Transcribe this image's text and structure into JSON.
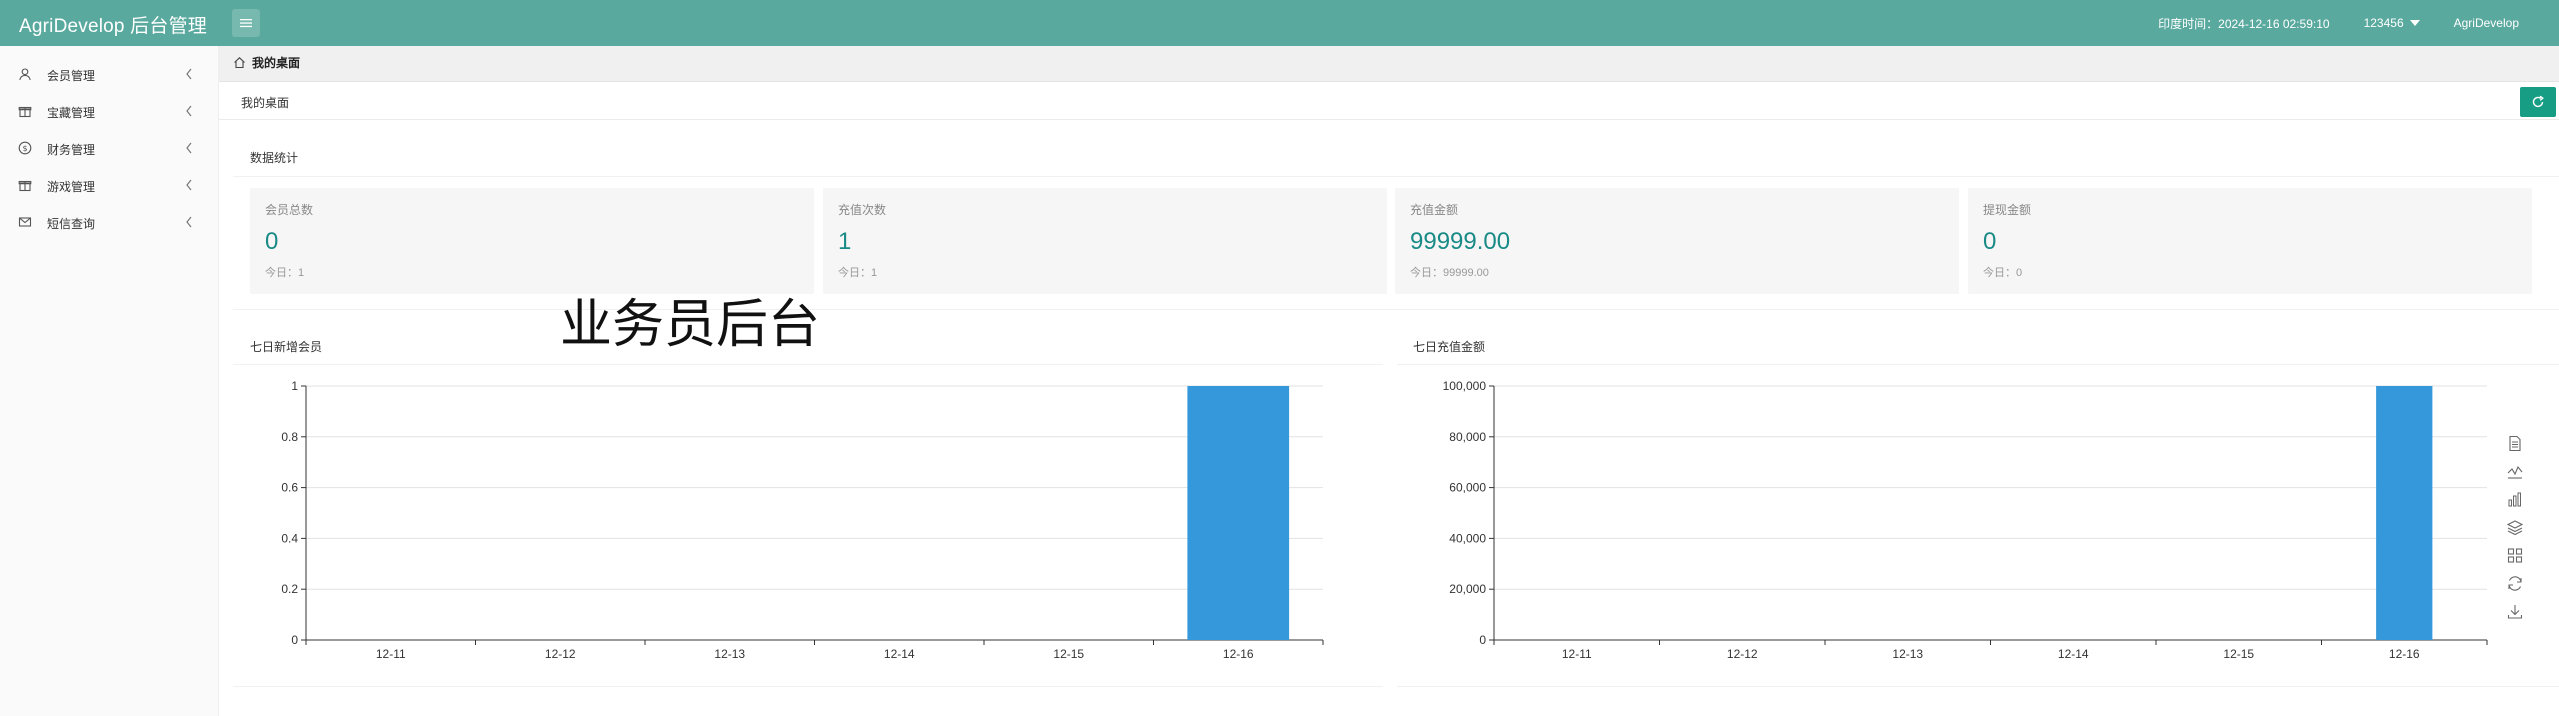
{
  "header": {
    "logo": "AgriDevelop 后台管理",
    "time_label": "印度时间：2024-12-16 02:59:10",
    "user": "123456",
    "brand": "AgriDevelop"
  },
  "sidebar": {
    "items": [
      {
        "label": "会员管理",
        "icon": "user-icon"
      },
      {
        "label": "宝藏管理",
        "icon": "gift-icon"
      },
      {
        "label": "财务管理",
        "icon": "dollar-icon"
      },
      {
        "label": "游戏管理",
        "icon": "gift-icon"
      },
      {
        "label": "短信查询",
        "icon": "mail-icon"
      }
    ]
  },
  "tabs": [
    {
      "label": "我的桌面"
    }
  ],
  "breadcrumb": "我的桌面",
  "stats_title": "数据统计",
  "stats": [
    {
      "label": "会员总数",
      "value": "0",
      "today": "今日：1"
    },
    {
      "label": "充值次数",
      "value": "1",
      "today": "今日：1"
    },
    {
      "label": "充值金额",
      "value": "99999.00",
      "today": "今日：99999.00"
    },
    {
      "label": "提现金额",
      "value": "0",
      "today": "今日：0"
    }
  ],
  "watermark": "业务员后台",
  "colors": {
    "header": "#5aa99e",
    "accent": "#198a86",
    "bar": "#3598db",
    "refresh": "#169d84"
  },
  "chart_data": [
    {
      "type": "bar",
      "title": "七日新增会员",
      "categories": [
        "12-11",
        "12-12",
        "12-13",
        "12-14",
        "12-15",
        "12-16"
      ],
      "values": [
        0,
        0,
        0,
        0,
        0,
        1
      ],
      "ylim": [
        0,
        1
      ],
      "yticks": [
        "0",
        "0.2",
        "0.4",
        "0.6",
        "0.8",
        "1"
      ],
      "grid": true
    },
    {
      "type": "bar",
      "title": "七日充值金额",
      "categories": [
        "12-11",
        "12-12",
        "12-13",
        "12-14",
        "12-15",
        "12-16"
      ],
      "values": [
        0,
        0,
        0,
        0,
        0,
        99999
      ],
      "ylim": [
        0,
        100000
      ],
      "yticks": [
        "0",
        "20,000",
        "40,000",
        "60,000",
        "80,000",
        "100,000"
      ],
      "grid": true
    }
  ],
  "toolbox": [
    "data-view-icon",
    "line-chart-icon",
    "bar-chart-icon",
    "stack-icon",
    "tiled-icon",
    "restore-icon",
    "save-image-icon"
  ]
}
